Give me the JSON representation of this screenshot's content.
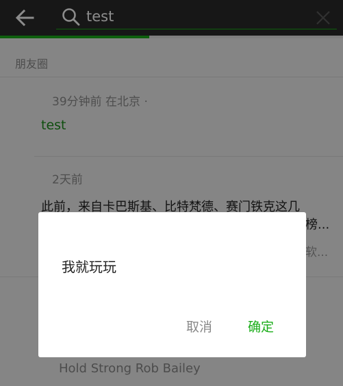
{
  "header": {
    "search_value": "test",
    "progress_fraction": 0.435
  },
  "feed": {
    "section_label": "朋友圈",
    "posts": [
      {
        "meta": "39分钟前   在北京 ·",
        "text": "test"
      },
      {
        "meta": "2天前",
        "text_line1": "此前，来自卡巴斯基、比特梵德、赛门铁克这几",
        "text_line2_tail": "榜...",
        "sub_tail": "软..."
      }
    ],
    "music_title": "Hold Strong Rob Bailey"
  },
  "dialog": {
    "message": "我就玩玩",
    "cancel_label": "取消",
    "confirm_label": "确定"
  },
  "colors": {
    "accent": "#1aad19",
    "topbar": "#2b2b2b"
  }
}
